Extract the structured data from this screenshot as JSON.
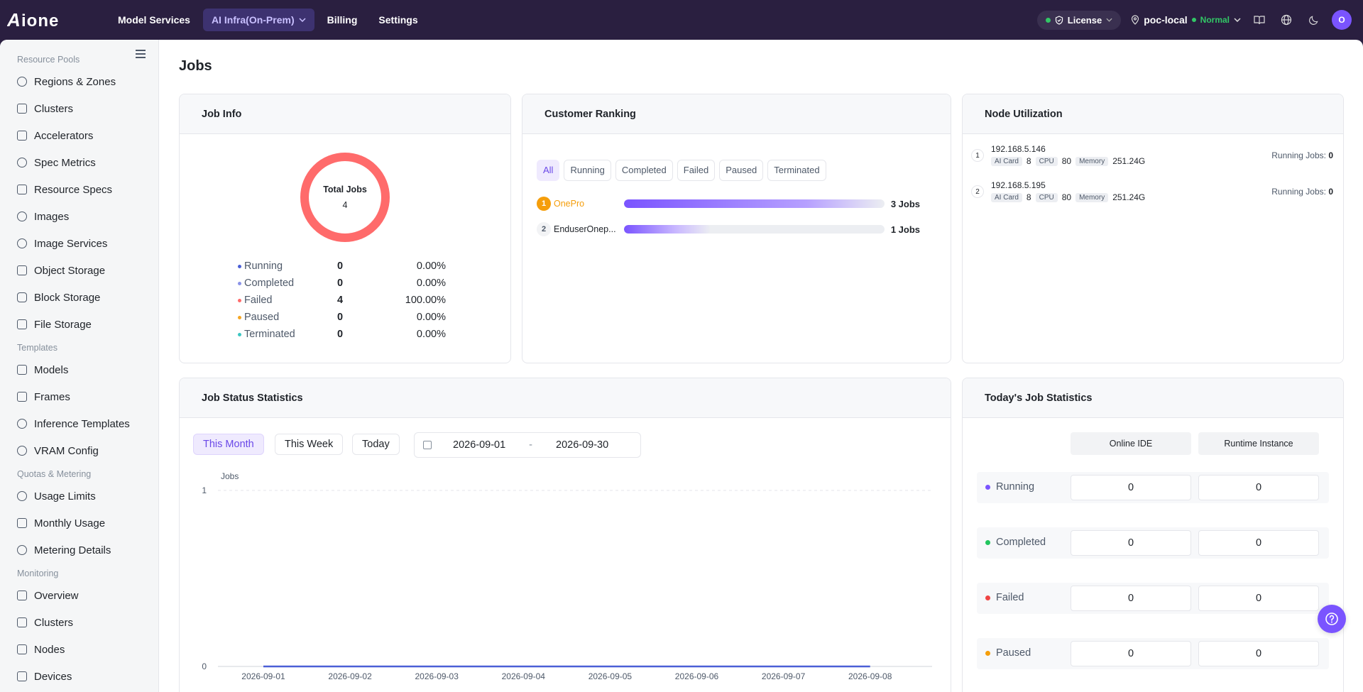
{
  "brand": "AIONE",
  "topnav": {
    "items": [
      "Model Services",
      "AI Infra(On-Prem)",
      "Billing",
      "Settings"
    ],
    "license_label": "License",
    "env_name": "poc-local",
    "env_status": "Normal",
    "avatar_initial": "O"
  },
  "sidebar": {
    "groups": {
      "resource_pools": "Resource Pools",
      "templates": "Templates",
      "quotas": "Quotas & Metering",
      "monitoring": "Monitoring"
    },
    "resource_items": [
      "Regions & Zones",
      "Clusters",
      "Accelerators",
      "Spec Metrics",
      "Resource Specs",
      "Images",
      "Image Services",
      "Object Storage",
      "Block Storage",
      "File Storage"
    ],
    "template_items": [
      "Models",
      "Frames",
      "Inference Templates",
      "VRAM Config"
    ],
    "quota_items": [
      "Usage Limits",
      "Monthly Usage",
      "Metering Details"
    ],
    "monitoring_items": [
      "Overview",
      "Clusters",
      "Nodes",
      "Devices"
    ]
  },
  "page": {
    "title": "Jobs"
  },
  "job_info": {
    "title": "Job Info",
    "total_label": "Total Jobs",
    "total_value": "4",
    "rows": [
      {
        "name": "Running",
        "count": "0",
        "pct": "0.00%",
        "color": "#4b5fd6"
      },
      {
        "name": "Completed",
        "count": "0",
        "pct": "0.00%",
        "color": "#8b93e8"
      },
      {
        "name": "Failed",
        "count": "4",
        "pct": "100.00%",
        "color": "#ff6b6b"
      },
      {
        "name": "Paused",
        "count": "0",
        "pct": "0.00%",
        "color": "#f5a623"
      },
      {
        "name": "Terminated",
        "count": "0",
        "pct": "0.00%",
        "color": "#3cc6c2"
      }
    ]
  },
  "ranking": {
    "title": "Customer Ranking",
    "tabs": [
      "All",
      "Running",
      "Completed",
      "Failed",
      "Paused",
      "Terminated"
    ],
    "rows": [
      {
        "rank": "1",
        "name": "OnePro",
        "value": "3 Jobs",
        "fraction": 1.0
      },
      {
        "rank": "2",
        "name": "EnduserOnep...",
        "value": "1 Jobs",
        "fraction": 0.333
      }
    ]
  },
  "nodes": {
    "title": "Node Utilization",
    "rows": [
      {
        "idx": "1",
        "ip": "192.168.5.146",
        "card_label": "AI Card",
        "card": "8",
        "cpu_label": "CPU",
        "cpu": "80",
        "mem_label": "Memory",
        "mem": "251.24G",
        "running_label": "Running Jobs:",
        "running": "0"
      },
      {
        "idx": "2",
        "ip": "192.168.5.195",
        "card_label": "AI Card",
        "card": "8",
        "cpu_label": "CPU",
        "cpu": "80",
        "mem_label": "Memory",
        "mem": "251.24G",
        "running_label": "Running Jobs:",
        "running": "0"
      }
    ]
  },
  "status_stats": {
    "title": "Job Status Statistics",
    "ranges": [
      "This Month",
      "This Week",
      "Today"
    ],
    "start_date": "2026-09-01",
    "date_sep": "-",
    "end_date": "2026-09-30"
  },
  "chart_data": {
    "type": "line",
    "ylabel": "Jobs",
    "ylim": [
      0,
      1
    ],
    "yticks": [
      "0",
      "1"
    ],
    "x": [
      "2026-09-01",
      "2026-09-02",
      "2026-09-03",
      "2026-09-04",
      "2026-09-05",
      "2026-09-06",
      "2026-09-07",
      "2026-09-08"
    ],
    "series": [
      {
        "values": [
          0,
          0,
          0,
          0,
          0,
          0,
          0,
          0
        ],
        "color": "#4b5fd6"
      }
    ],
    "grid": true
  },
  "today_stats": {
    "title": "Today's Job Statistics",
    "columns": [
      "Online IDE",
      "Runtime Instance"
    ],
    "rows": [
      {
        "name": "Running",
        "color": "#7a54ff",
        "ide": "0",
        "runtime": "0"
      },
      {
        "name": "Completed",
        "color": "#22c55e",
        "ide": "0",
        "runtime": "0"
      },
      {
        "name": "Failed",
        "color": "#ef4444",
        "ide": "0",
        "runtime": "0"
      },
      {
        "name": "Paused",
        "color": "#f59e0b",
        "ide": "0",
        "runtime": "0"
      }
    ]
  }
}
